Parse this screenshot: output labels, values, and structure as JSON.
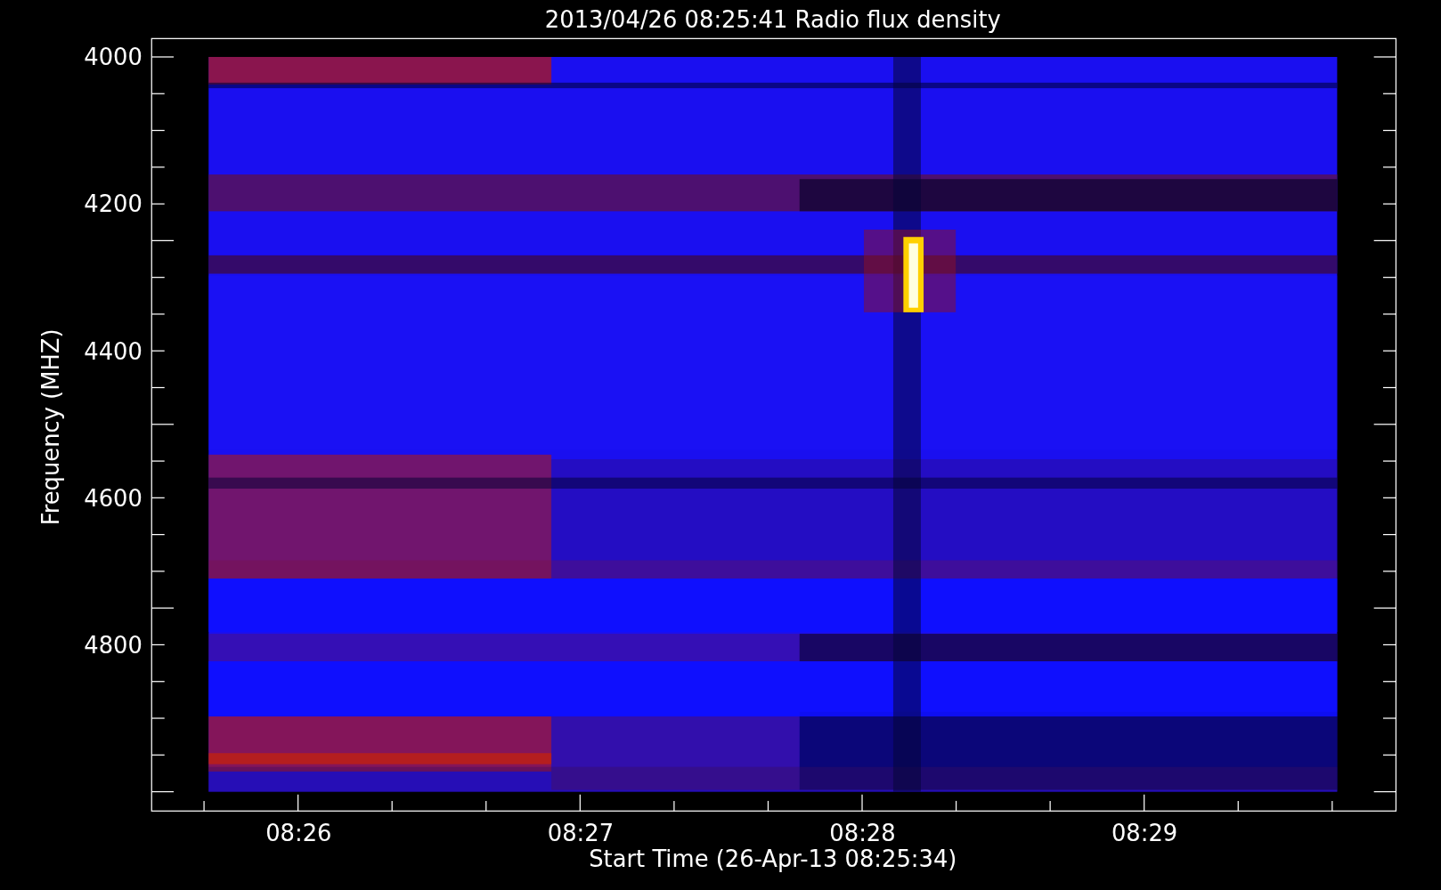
{
  "title": "2013/04/26 08:25:41 Radio flux density",
  "y_axis": {
    "label": "Frequency (MHZ)",
    "ticks": [
      "4000",
      "4200",
      "4400",
      "4600",
      "4800"
    ]
  },
  "x_axis": {
    "label": "Start Time (26-Apr-13 08:25:34)",
    "ticks": [
      "08:26",
      "08:27",
      "08:28",
      "08:29"
    ]
  }
}
